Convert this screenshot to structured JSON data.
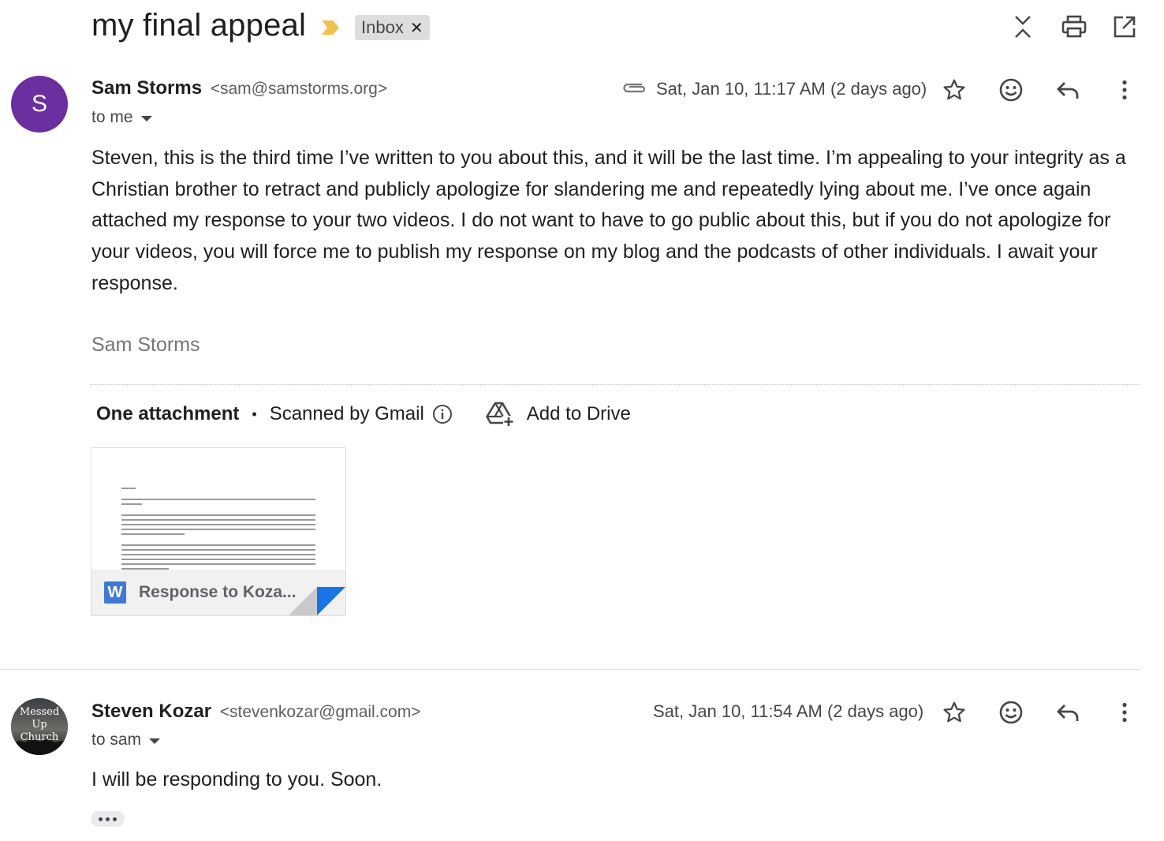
{
  "thread": {
    "subject": "my final appeal",
    "label": "Inbox",
    "importance_color": "#f2c04d"
  },
  "toolbar": {
    "icons": [
      "collapse-all-icon",
      "print-icon",
      "open-in-new-window-icon"
    ]
  },
  "messages": [
    {
      "avatar_letter": "S",
      "avatar_color": "#6b2fa0",
      "sender_name": "Sam Storms",
      "sender_email": "<sam@samstorms.org>",
      "to": "to me",
      "date": "Sat, Jan 10, 11:17 AM (2 days ago)",
      "has_attachment": true,
      "body": "Steven, this is the third time I’ve written to you about this, and it will be the last time. I’m appealing to your integrity as a Christian brother to retract and publicly apologize for slandering me and repeatedly lying about me. I’ve once again attached my response to your two videos. I do not want to have to go public about this, but if you do not apologize for your videos, you will force me to publish my response on my blog and the podcasts of other individuals. I await your response.",
      "signature": "Sam Storms",
      "attachments": {
        "count_label": "One attachment",
        "scan_label": "Scanned by Gmail",
        "drive_label": "Add to Drive",
        "file_name": "Response to Koza...",
        "file_type_letter": "W"
      }
    },
    {
      "avatar_text": "Messed Up Church",
      "sender_name": "Steven Kozar",
      "sender_email": "<stevenkozar@gmail.com>",
      "to": "to sam",
      "date": "Sat, Jan 10, 11:54 AM (2 days ago)",
      "body": "I will be responding to you. Soon."
    }
  ],
  "colors": {
    "text_primary": "#1f1f1f",
    "text_secondary": "#444746",
    "word_blue": "#3f79d8"
  }
}
